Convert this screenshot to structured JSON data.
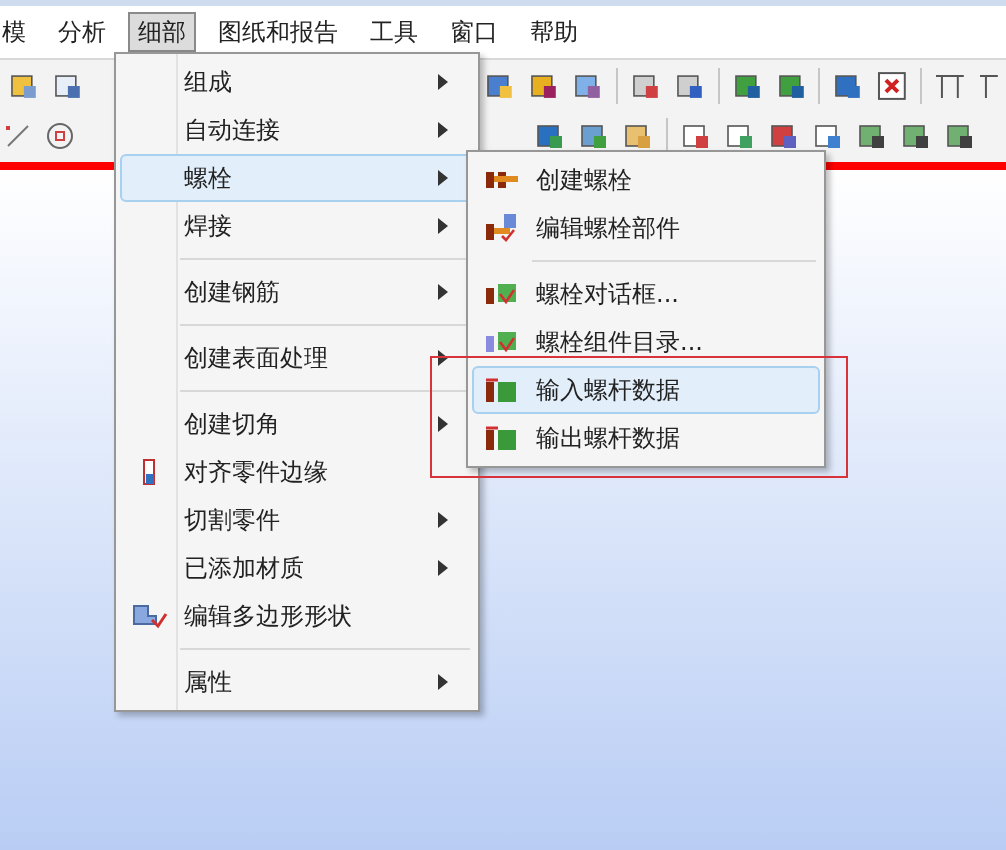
{
  "menubar": [
    {
      "label": "模",
      "selected": false
    },
    {
      "label": "分析",
      "selected": false
    },
    {
      "label": "细部",
      "selected": true
    },
    {
      "label": "图纸和报告",
      "selected": false
    },
    {
      "label": "工具",
      "selected": false
    },
    {
      "label": "窗口",
      "selected": false
    },
    {
      "label": "帮助",
      "selected": false
    }
  ],
  "menu": [
    {
      "kind": "item",
      "label": "组成",
      "submenu": true,
      "selected": false
    },
    {
      "kind": "item",
      "label": "自动连接",
      "submenu": true,
      "selected": false
    },
    {
      "kind": "item",
      "label": "螺栓",
      "submenu": true,
      "selected": true
    },
    {
      "kind": "item",
      "label": "焊接",
      "submenu": true,
      "selected": false
    },
    {
      "kind": "separator"
    },
    {
      "kind": "item",
      "label": "创建钢筋",
      "submenu": true,
      "selected": false
    },
    {
      "kind": "separator"
    },
    {
      "kind": "item",
      "label": "创建表面处理",
      "submenu": true,
      "selected": false
    },
    {
      "kind": "separator"
    },
    {
      "kind": "item",
      "label": "创建切角",
      "submenu": true,
      "selected": false
    },
    {
      "kind": "item",
      "label": "对齐零件边缘",
      "submenu": false,
      "selected": false
    },
    {
      "kind": "item",
      "label": "切割零件",
      "submenu": true,
      "selected": false
    },
    {
      "kind": "item",
      "label": "已添加材质",
      "submenu": true,
      "selected": false
    },
    {
      "kind": "item",
      "label": "编辑多边形形状",
      "submenu": false,
      "selected": false
    },
    {
      "kind": "separator"
    },
    {
      "kind": "item",
      "label": "属性",
      "submenu": true,
      "selected": false
    }
  ],
  "submenu": [
    {
      "kind": "item",
      "label": "创建螺栓",
      "selected": false
    },
    {
      "kind": "item",
      "label": "编辑螺栓部件",
      "selected": false
    },
    {
      "kind": "separator"
    },
    {
      "kind": "item",
      "label": "螺栓对话框...",
      "selected": false
    },
    {
      "kind": "item",
      "label": "螺栓组件目录...",
      "selected": false
    },
    {
      "kind": "item",
      "label": "输入螺杆数据",
      "selected": true
    },
    {
      "kind": "item",
      "label": "输出螺杆数据",
      "selected": false
    }
  ]
}
